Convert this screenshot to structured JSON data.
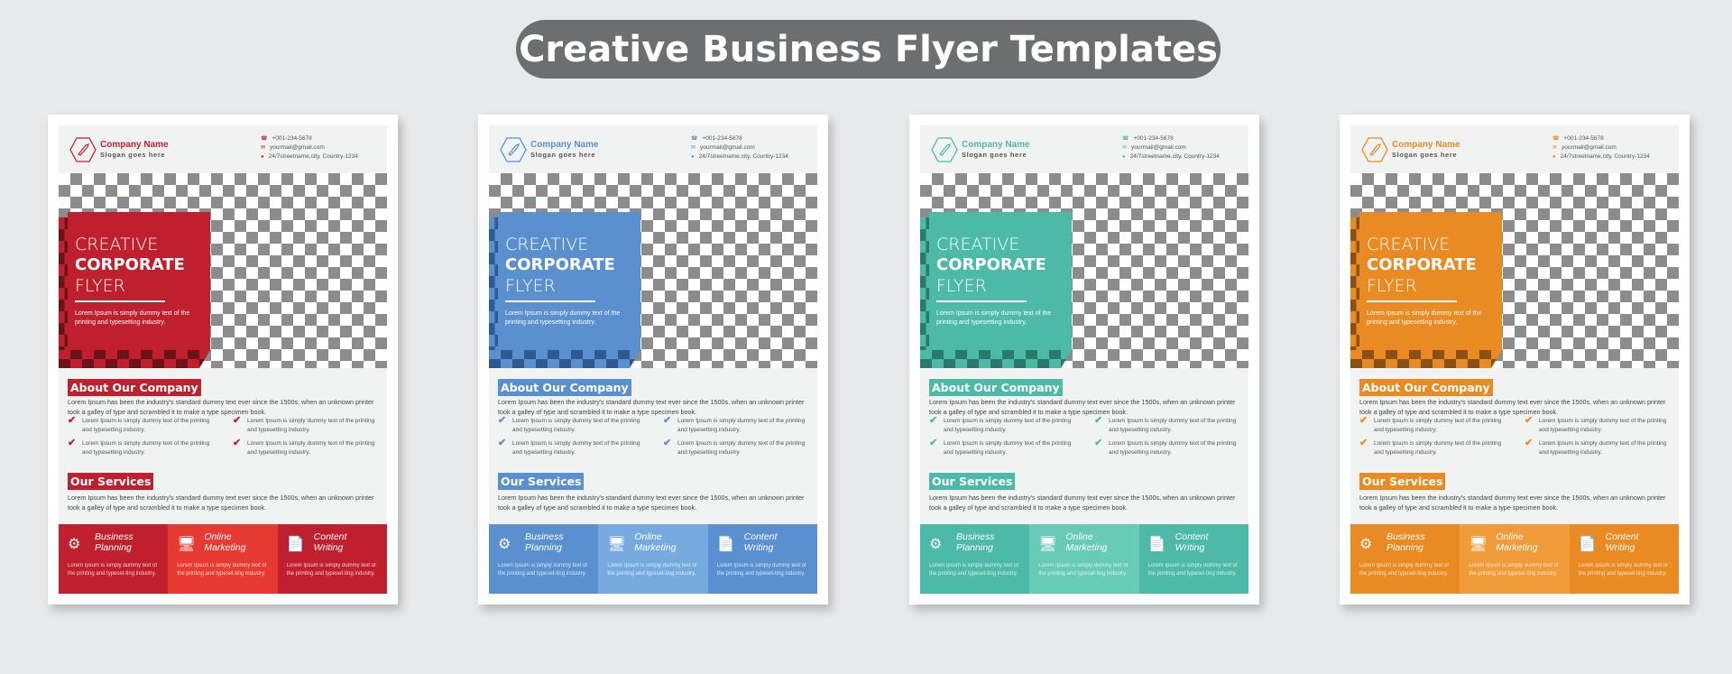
{
  "title": "Creative Business Flyer Templates",
  "flyer": {
    "company_name": "Company Name",
    "slogan": "Slogan goes here",
    "phone": "+001-234-5678",
    "email": "yourmail@gmail.com",
    "address": "24/7streetname,city, Country-1234",
    "hero": {
      "line1": "CREATIVE",
      "line2": "CORPORATE",
      "line3": "FLYER",
      "desc": "Lorem Ipsum is simply dummy text of the printing and typesetting industry."
    },
    "about_title": "About Our Company",
    "about_text": "Lorem Ipsum has been the industry's standard dummy text ever since the 1500s, when an unknown printer took a galley of type and scrambled it to make a type specimen book.",
    "checklist": [
      "Lorem Ipsum is simply dummy text of the printing and typesetting industry.",
      "Lorem Ipsum is simply dummy text of the printing and typesetting industry.",
      "Lorem Ipsum is simply dummy text of the printing and typesetting industry.",
      "Lorem Ipsum is simply dummy text of the printing and typesetting industry."
    ],
    "services_title": "Our Services",
    "services_text": "Lorem Ipsum has been the industry's standard dummy text ever since the 1500s, when an unknown printer took a galley of type and scrambled it to make a type specimen book.",
    "services": [
      {
        "name1": "Business",
        "name2": "Planning",
        "icon": "business-planning-icon",
        "desc": "Lorem Ipsum is simply dummy text of the printing and typeset-ting industry."
      },
      {
        "name1": "Online",
        "name2": "Marketing",
        "icon": "online-marketing-icon",
        "desc": "Lorem Ipsum is simply dummy text of the printing and typeset-ting industry."
      },
      {
        "name1": "Content",
        "name2": "Writing",
        "icon": "content-writing-icon",
        "desc": "Lorem Ipsum is simply dummy text of the printing and typeset-ting industry."
      }
    ]
  },
  "variants": [
    {
      "name": "red",
      "accent": "#c0202e",
      "dark": "#6e1219",
      "light": "#e63a32"
    },
    {
      "name": "blue",
      "accent": "#5a8fd0",
      "dark": "#2f5a8f",
      "light": "#76aadf"
    },
    {
      "name": "teal",
      "accent": "#4dbaa7",
      "dark": "#2a7a6c",
      "light": "#67cbb8"
    },
    {
      "name": "orange",
      "accent": "#e98a22",
      "dark": "#8a5014",
      "light": "#f09c3a"
    }
  ]
}
